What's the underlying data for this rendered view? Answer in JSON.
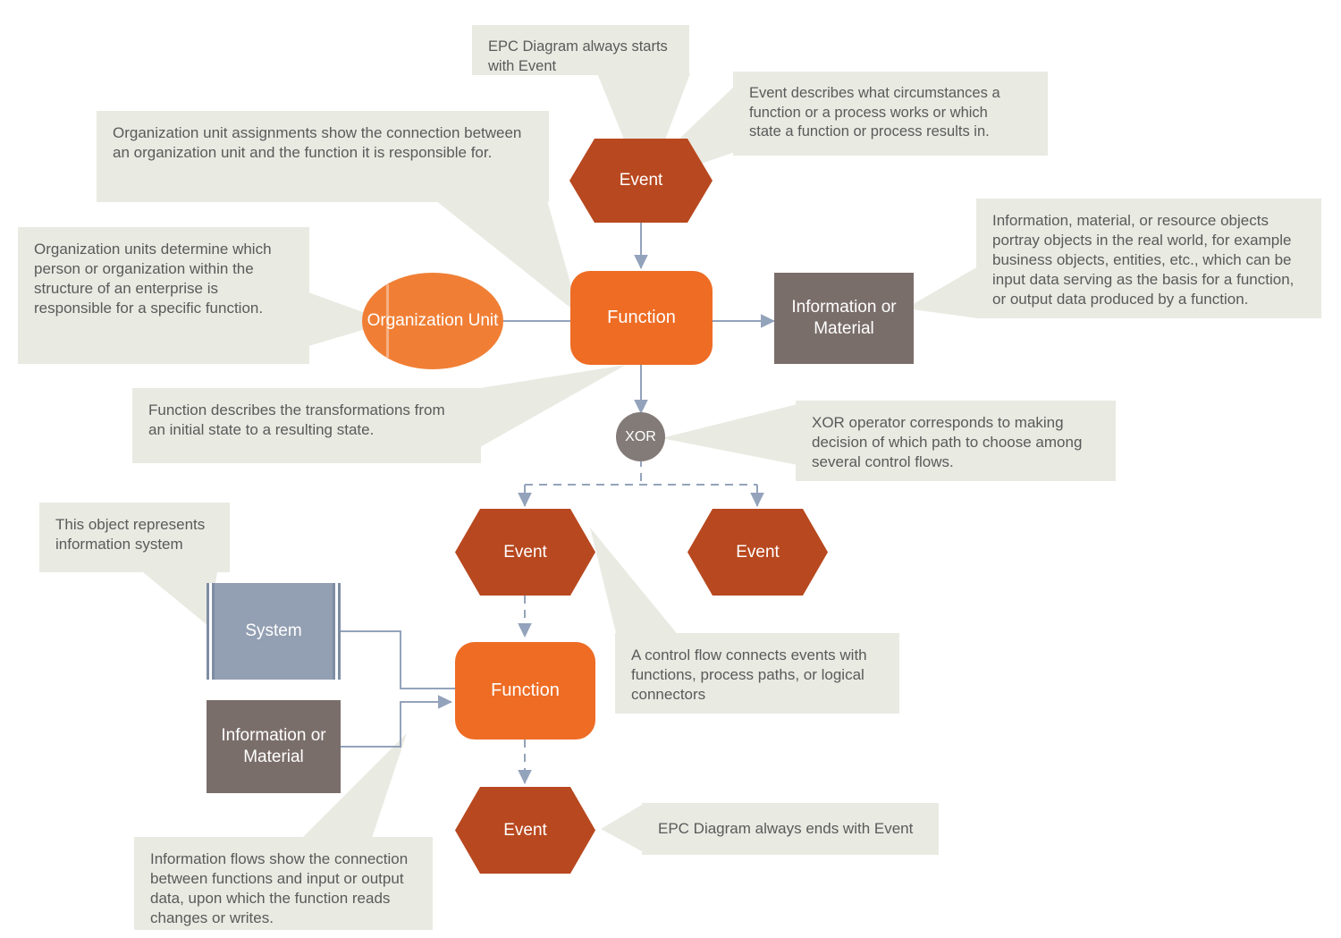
{
  "diagram": {
    "title": "EPC Diagram Elements",
    "colors": {
      "event": "#b8481f",
      "function": "#ee6c24",
      "organization_unit": "#f07f35",
      "information_or_material": "#7a6e6a",
      "system": "#939fb2",
      "xor": "#837b78",
      "note_background": "#e9eae2",
      "note_text": "#5a5a5a",
      "connector": "#93a3bb"
    },
    "nodes": {
      "event_start": "Event",
      "function_top": "Function",
      "organization_unit": "Organization\nUnit",
      "information_or_material_top": "Information or\nMaterial",
      "xor": "XOR",
      "event_branch_left": "Event",
      "event_branch_right": "Event",
      "system": "System",
      "information_or_material_bottom": "Information or\nMaterial",
      "function_bottom": "Function",
      "event_end": "Event"
    },
    "notes": {
      "starts_with_event": "EPC Diagram always starts\nwith Event",
      "event_description": "Event describes what circumstances a\nfunction or a process works or which\nstate a function or process results in.",
      "org_unit_assignment": "Organization unit assignments show the connection between\nan organization unit and the function it is responsible for.",
      "org_unit_description": "Organization units determine which\nperson or organization within the\nstructure of an enterprise is\nresponsible for a specific function.",
      "information_description": "Information, material, or resource objects\nportray objects in the real world, for example\nbusiness objects, entities, etc., which can be\ninput data serving as the basis for a function,\nor output data produced by a function.",
      "function_description": "Function describes the transformations from\nan initial state to a resulting state.",
      "xor_description": "XOR operator corresponds to making\ndecision of which path to choose among\nseveral control flows.",
      "system_description": "This object represents\ninformation system",
      "control_flow_description": "A control flow connects events with\nfunctions, process paths, or logical\nconnectors",
      "information_flow_description": "Information flows show the connection\nbetween functions and input or output\ndata, upon which the function reads\nchanges or writes.",
      "ends_with_event": "EPC Diagram always ends with Event"
    }
  }
}
